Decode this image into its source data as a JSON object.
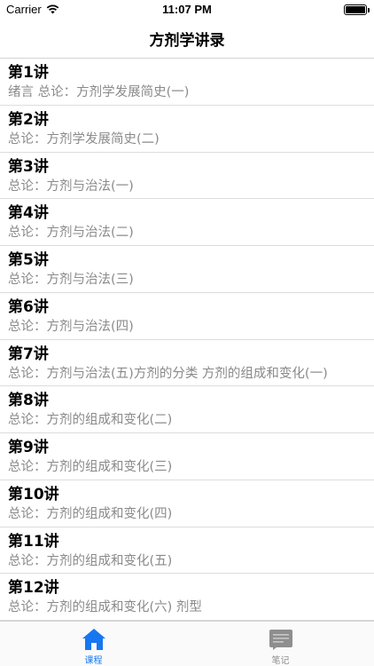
{
  "status_bar": {
    "carrier": "Carrier",
    "time": "11:07 PM"
  },
  "nav": {
    "title": "方剂学讲录"
  },
  "lessons": [
    {
      "title": "第1讲",
      "subtitle": "绪言 总论：方剂学发展简史(一)"
    },
    {
      "title": "第2讲",
      "subtitle": "总论：方剂学发展简史(二)"
    },
    {
      "title": "第3讲",
      "subtitle": "总论：方剂与治法(一)"
    },
    {
      "title": "第4讲",
      "subtitle": "总论：方剂与治法(二)"
    },
    {
      "title": "第5讲",
      "subtitle": "总论：方剂与治法(三)"
    },
    {
      "title": "第6讲",
      "subtitle": "总论：方剂与治法(四)"
    },
    {
      "title": "第7讲",
      "subtitle": "总论：方剂与治法(五)方剂的分类 方剂的组成和变化(一)"
    },
    {
      "title": "第8讲",
      "subtitle": "总论：方剂的组成和变化(二)"
    },
    {
      "title": "第9讲",
      "subtitle": "总论：方剂的组成和变化(三)"
    },
    {
      "title": "第10讲",
      "subtitle": "总论：方剂的组成和变化(四)"
    },
    {
      "title": "第11讲",
      "subtitle": "总论：方剂的组成和变化(五)"
    },
    {
      "title": "第12讲",
      "subtitle": "总论：方剂的组成和变化(六) 剂型"
    }
  ],
  "tabs": [
    {
      "label": "课程",
      "icon": "home-icon",
      "active": true
    },
    {
      "label": "笔记",
      "icon": "notebook-icon",
      "active": false
    }
  ],
  "colors": {
    "accent": "#1677f1",
    "inactive": "#8e8e8e",
    "subtitle": "#8a8a8a"
  }
}
